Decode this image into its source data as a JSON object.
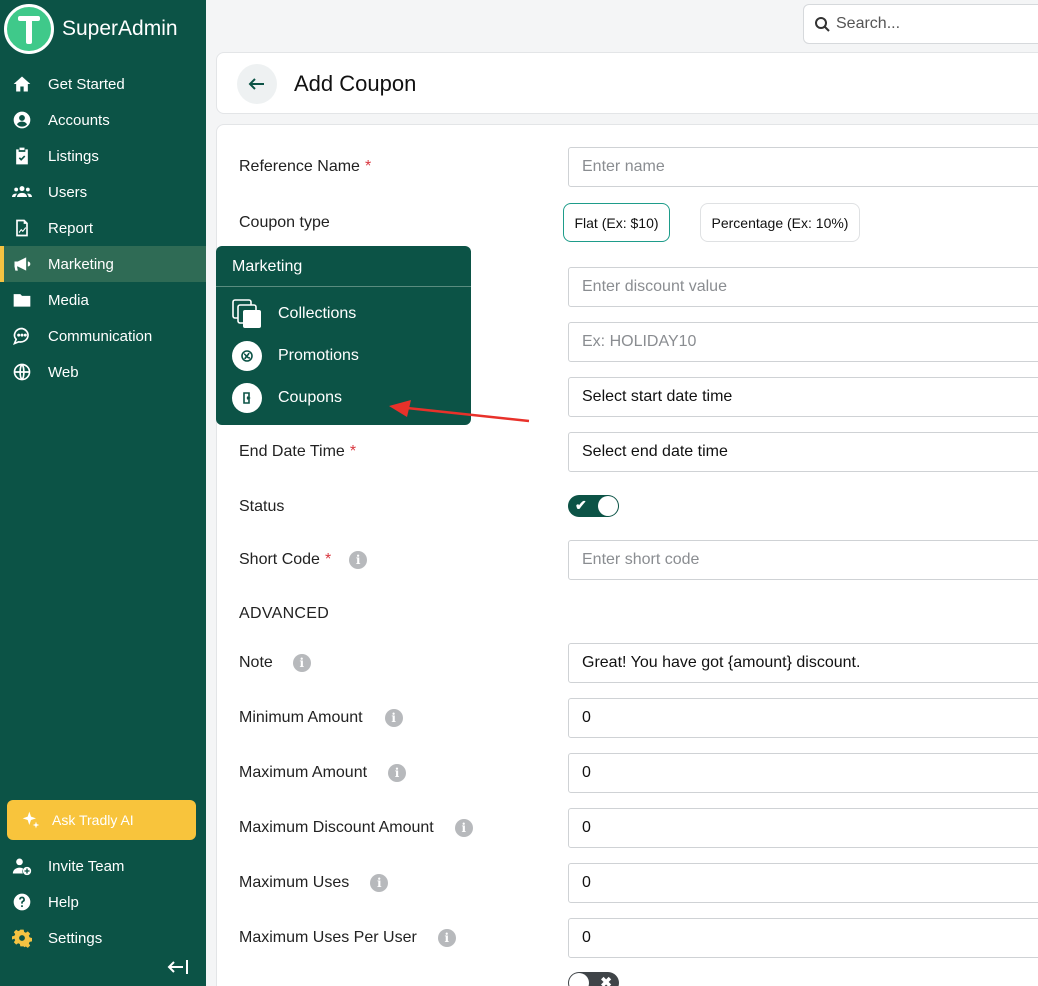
{
  "brand": {
    "name": "SuperAdmin"
  },
  "sidebar": {
    "items": [
      {
        "label": "Get Started",
        "icon": "home-icon"
      },
      {
        "label": "Accounts",
        "icon": "user-circle-icon"
      },
      {
        "label": "Listings",
        "icon": "clipboard-check-icon"
      },
      {
        "label": "Users",
        "icon": "users-icon"
      },
      {
        "label": "Report",
        "icon": "report-icon"
      },
      {
        "label": "Marketing",
        "icon": "megaphone-icon",
        "active": true
      },
      {
        "label": "Media",
        "icon": "folder-icon"
      },
      {
        "label": "Communication",
        "icon": "chat-icon"
      },
      {
        "label": "Web",
        "icon": "globe-icon"
      }
    ],
    "ask_ai": "Ask Tradly AI",
    "bottom_items": [
      {
        "label": "Invite Team",
        "icon": "user-plus-icon"
      },
      {
        "label": "Help",
        "icon": "help-icon"
      },
      {
        "label": "Settings",
        "icon": "gear-icon"
      }
    ]
  },
  "search": {
    "placeholder": "Search..."
  },
  "header": {
    "title": "Add Coupon"
  },
  "form": {
    "reference_name": {
      "label": "Reference Name",
      "placeholder": "Enter name"
    },
    "coupon_type": {
      "label": "Coupon type",
      "options": [
        "Flat (Ex: $10)",
        "Percentage (Ex: 10%)"
      ],
      "selected": "Flat (Ex: $10)"
    },
    "discount_value": {
      "placeholder": "Enter discount value"
    },
    "coupon_code": {
      "placeholder": "Ex: HOLIDAY10"
    },
    "start_date": {
      "value": "Select start date time"
    },
    "end_date": {
      "label": "End Date Time",
      "value": "Select end date time"
    },
    "status": {
      "label": "Status",
      "on": true
    },
    "short_code": {
      "label": "Short Code",
      "placeholder": "Enter short code"
    },
    "advanced_heading": "ADVANCED",
    "note": {
      "label": "Note",
      "value": "Great! You have got {amount} discount."
    },
    "minimum_amount": {
      "label": "Minimum Amount",
      "value": "0"
    },
    "maximum_amount": {
      "label": "Maximum Amount",
      "value": "0"
    },
    "maximum_discount_amount": {
      "label": "Maximum Discount Amount",
      "value": "0"
    },
    "maximum_uses": {
      "label": "Maximum Uses",
      "value": "0"
    },
    "maximum_uses_per_user": {
      "label": "Maximum Uses Per User",
      "value": "0"
    },
    "extra_toggle": {
      "on": false
    }
  },
  "flyout": {
    "title": "Marketing",
    "items": [
      {
        "label": "Collections",
        "icon": "collections-icon"
      },
      {
        "label": "Promotions",
        "icon": "promotions-icon"
      },
      {
        "label": "Coupons",
        "icon": "coupon-icon"
      }
    ]
  },
  "colors": {
    "sidebar_bg": "#0c5346",
    "accent": "#f8c43c",
    "required": "#d9373f",
    "annotation_arrow": "#e8312a"
  }
}
